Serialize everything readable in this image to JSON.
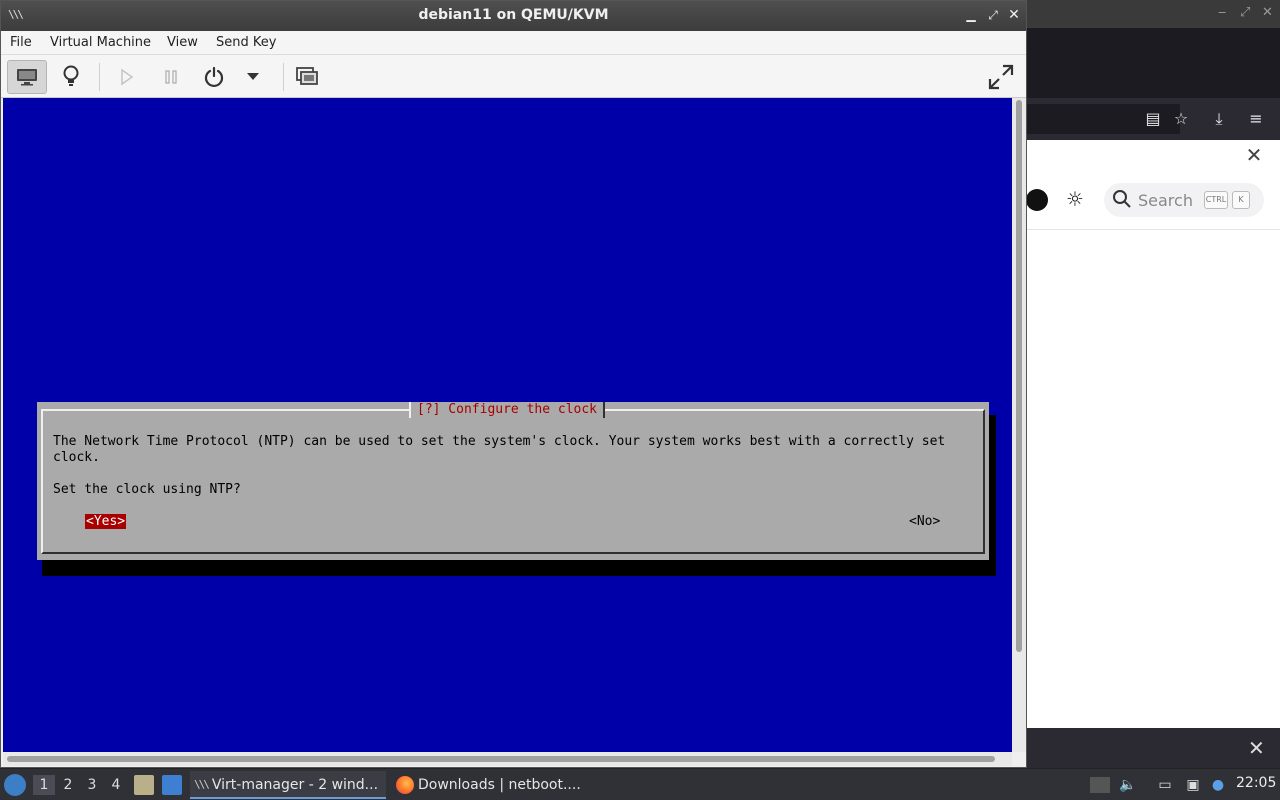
{
  "background_browser": {
    "search_placeholder": "Search",
    "kbd_ctrl": "CTRL",
    "kbd_k": "K"
  },
  "vm_window": {
    "title": "debian11 on QEMU/KVM",
    "menu": {
      "file": "File",
      "virtual_machine": "Virtual Machine",
      "view": "View",
      "send_key": "Send Key"
    },
    "toolbar_icons": [
      "monitor-icon",
      "lightbulb-icon",
      "play-icon",
      "pause-icon",
      "power-icon",
      "dropdown-arrow-icon",
      "snapshots-icon",
      "fullscreen-icon"
    ]
  },
  "installer": {
    "dialog_title": "[?] Configure the clock",
    "body_line1": "The Network Time Protocol (NTP) can be used to set the system's clock. Your system works best with a correctly set",
    "body_line2": "clock.",
    "question": "Set the clock using NTP?",
    "yes_label": "<Yes>",
    "no_label": "<No>",
    "colors": {
      "background": "#0000a8",
      "dialog": "#aaaaaa",
      "title": "#a80000",
      "selected": "#a80000"
    }
  },
  "taskbar": {
    "workspaces": [
      "1",
      "2",
      "3",
      "4"
    ],
    "active_workspace": "1",
    "tasks": [
      {
        "label": "Virt-manager - 2 wind...",
        "active": true
      },
      {
        "label": "Downloads | netboot....",
        "active": false
      }
    ],
    "clock": "22:05"
  }
}
